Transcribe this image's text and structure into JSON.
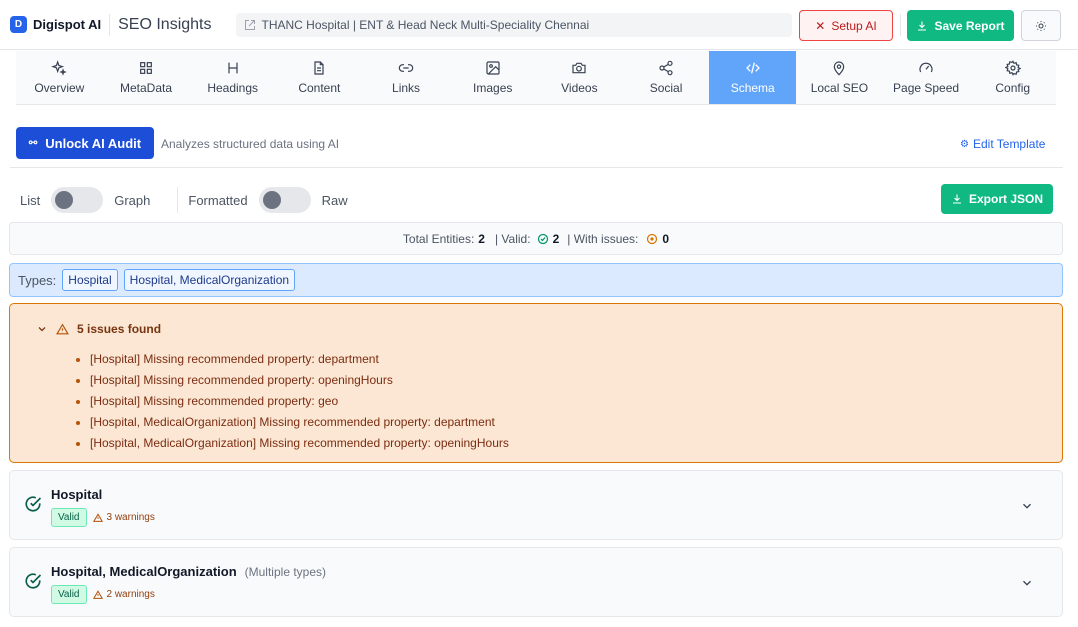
{
  "header": {
    "logo_letter": "D",
    "brand": "Digispot AI",
    "app_title": "SEO Insights",
    "page_title": "THANC Hospital | ENT & Head Neck Multi-Speciality Chennai",
    "setup_ai_label": "Setup AI",
    "save_report_label": "Save Report"
  },
  "tabs": [
    {
      "label": "Overview",
      "icon": "sparkles-icon"
    },
    {
      "label": "MetaData",
      "icon": "grid-icon"
    },
    {
      "label": "Headings",
      "icon": "heading-icon"
    },
    {
      "label": "Content",
      "icon": "document-icon"
    },
    {
      "label": "Links",
      "icon": "link-icon"
    },
    {
      "label": "Images",
      "icon": "image-icon"
    },
    {
      "label": "Videos",
      "icon": "camera-icon"
    },
    {
      "label": "Social",
      "icon": "share-icon"
    },
    {
      "label": "Schema",
      "icon": "code-icon",
      "active": true
    },
    {
      "label": "Local SEO",
      "icon": "map-pin-icon"
    },
    {
      "label": "Page Speed",
      "icon": "gauge-icon"
    },
    {
      "label": "Config",
      "icon": "gear-icon"
    }
  ],
  "audit": {
    "unlock_label": "Unlock AI Audit",
    "description": "Analyzes structured data using AI",
    "edit_template_label": "Edit Template"
  },
  "view": {
    "list_label": "List",
    "graph_label": "Graph",
    "formatted_label": "Formatted",
    "raw_label": "Raw",
    "export_label": "Export JSON"
  },
  "summary": {
    "total_label": "Total Entities:",
    "total_value": "2",
    "valid_label": "| Valid:",
    "valid_value": "2",
    "issues_label": "| With issues:",
    "issues_value": "0"
  },
  "types": {
    "label": "Types:",
    "chips": [
      "Hospital",
      "Hospital, MedicalOrganization"
    ]
  },
  "issues": {
    "title": "5 issues found",
    "items": [
      "[Hospital] Missing recommended property: department",
      "[Hospital] Missing recommended property: openingHours",
      "[Hospital] Missing recommended property: geo",
      "[Hospital, MedicalOrganization] Missing recommended property: department",
      "[Hospital, MedicalOrganization] Missing recommended property: openingHours"
    ]
  },
  "entities": [
    {
      "title": "Hospital",
      "note": "",
      "badge": "Valid",
      "warnings": "3 warnings"
    },
    {
      "title": "Hospital, MedicalOrganization",
      "note": "(Multiple types)",
      "badge": "Valid",
      "warnings": "2 warnings"
    }
  ],
  "colors": {
    "primary": "#1d4ed8",
    "success": "#10b981",
    "active_tab": "#60a5fa",
    "warning_bg": "#fbe7d3"
  }
}
